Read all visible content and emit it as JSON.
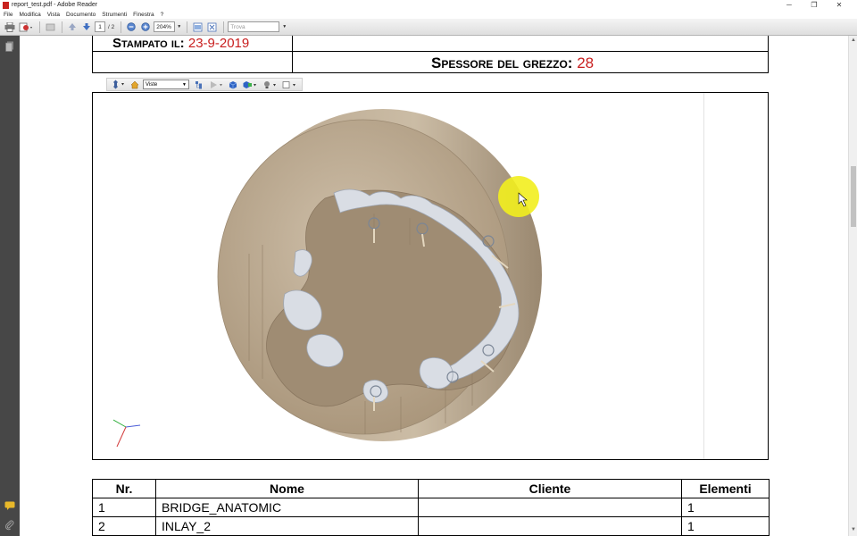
{
  "window": {
    "title": "report_test.pdf - Adobe Reader",
    "minimize": "─",
    "restore": "❐",
    "close": "✕"
  },
  "menu": [
    "File",
    "Modifica",
    "Vista",
    "Documento",
    "Strumenti",
    "Finestra",
    "?"
  ],
  "toolbar": {
    "current_page": "1",
    "total_pages": "/ 2",
    "zoom": "204%",
    "search_placeholder": "Trova"
  },
  "header": {
    "stampato_label": "Stampato il:",
    "stampato_value": "23-9-2019",
    "spessore_label": "Spessore del grezzo:",
    "spessore_value": "28"
  },
  "viewer3d": {
    "views_select": "Viste"
  },
  "table": {
    "columns": [
      "Nr.",
      "Nome",
      "Cliente",
      "Elementi"
    ],
    "rows": [
      [
        "1",
        "BRIDGE_ANATOMIC",
        "",
        "1"
      ],
      [
        "2",
        "INLAY_2",
        "",
        "1"
      ]
    ]
  },
  "colors": {
    "accent_red": "#c81e1e",
    "disc_tan": "#c9b9a2",
    "nav_dark": "#474747",
    "cursor_highlight": "#f2ee1e"
  }
}
